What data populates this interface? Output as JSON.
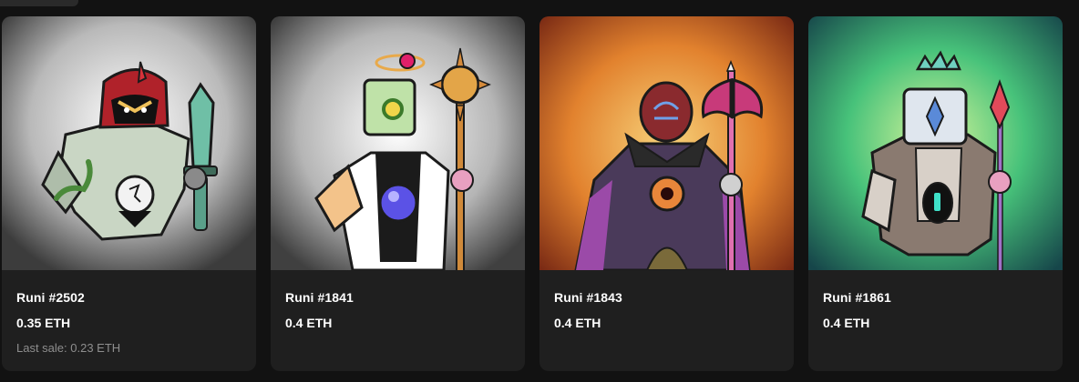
{
  "nfts": [
    {
      "name": "Runi #2502",
      "price": "0.35 ETH",
      "last_sale": "Last sale: 0.23 ETH",
      "background": "gray",
      "accent": "#9b1d20"
    },
    {
      "name": "Runi #1841",
      "price": "0.4 ETH",
      "background": "gray",
      "accent": "#e8b04a"
    },
    {
      "name": "Runi #1843",
      "price": "0.4 ETH",
      "background": "orange",
      "accent": "#e24a4a"
    },
    {
      "name": "Runi #1861",
      "price": "0.4 ETH",
      "background": "teal",
      "accent": "#2ecc9a"
    }
  ],
  "colors": {
    "page_bg": "#121212",
    "card_bg": "#1f1f1f",
    "text": "#ffffff",
    "muted_text": "#8e8e8e"
  }
}
